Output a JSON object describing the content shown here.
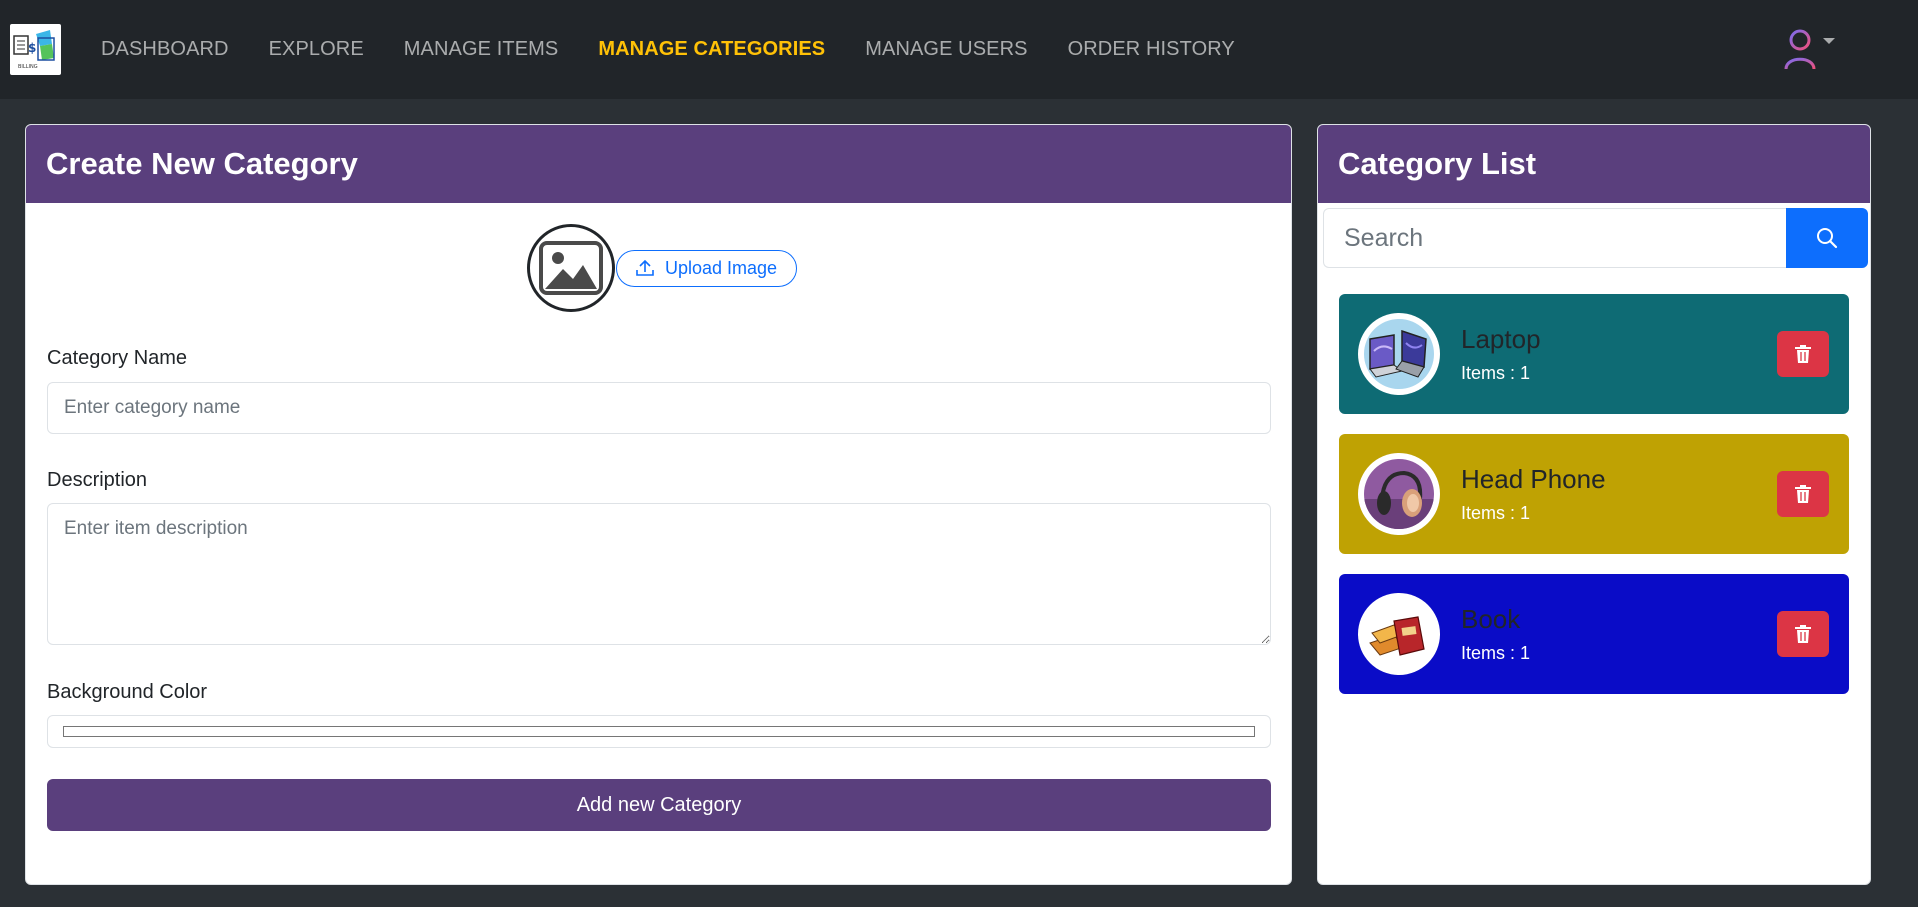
{
  "nav": {
    "links": [
      {
        "label": "DASHBOARD",
        "active": false
      },
      {
        "label": "EXPLORE",
        "active": false
      },
      {
        "label": "MANAGE ITEMS",
        "active": false
      },
      {
        "label": "MANAGE CATEGORIES",
        "active": true
      },
      {
        "label": "MANAGE USERS",
        "active": false
      },
      {
        "label": "ORDER HISTORY",
        "active": false
      }
    ],
    "active_color": "#ffc107"
  },
  "create_form": {
    "title": "Create New Category",
    "upload_label": "Upload Image",
    "name_label": "Category Name",
    "name_placeholder": "Enter category name",
    "name_value": "",
    "description_label": "Description",
    "description_placeholder": "Enter item description",
    "description_value": "",
    "bg_color_label": "Background Color",
    "bg_color_value": "#ffffff",
    "submit_label": "Add new Category"
  },
  "category_list": {
    "title": "Category List",
    "search_placeholder": "Search",
    "items": [
      {
        "name": "Laptop",
        "count": "Items : 1",
        "bg_color": "#0e6b74",
        "icon": "laptop-image"
      },
      {
        "name": "Head Phone",
        "count": "Items : 1",
        "bg_color": "#bfa203",
        "icon": "headphone-image"
      },
      {
        "name": "Book",
        "count": "Items : 1",
        "bg_color": "#0a0cc7",
        "icon": "book-image"
      }
    ]
  },
  "colors": {
    "header_purple": "#5a3f7d",
    "navbar": "#212529",
    "page_bg": "#2b3035",
    "primary": "#0d6efd",
    "danger": "#dc3545"
  }
}
